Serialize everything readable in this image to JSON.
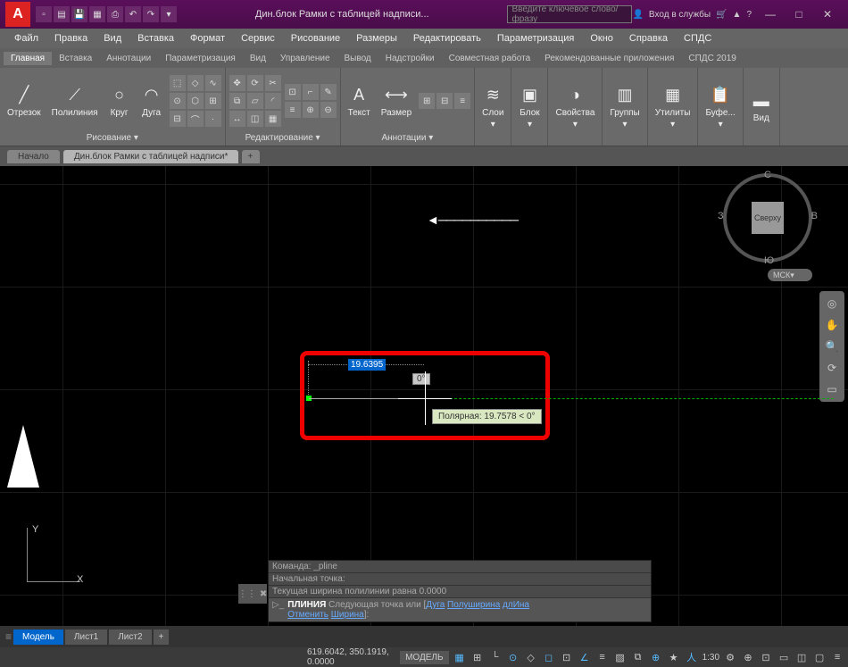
{
  "title": "Дин.блок Рамки с таблицей надписи...",
  "search_placeholder": "Введите ключевое слово/фразу",
  "login_label": "Вход в службы",
  "menus": [
    "Файл",
    "Правка",
    "Вид",
    "Вставка",
    "Формат",
    "Сервис",
    "Рисование",
    "Размеры",
    "Редактировать",
    "Параметризация",
    "Окно",
    "Справка",
    "СПДС"
  ],
  "ribbon_tabs": [
    "Главная",
    "Вставка",
    "Аннотации",
    "Параметризация",
    "Вид",
    "Управление",
    "Вывод",
    "Надстройки",
    "Совместная работа",
    "Рекомендованные приложения",
    "СПДС 2019"
  ],
  "panels": {
    "draw": {
      "title": "Рисование ▾",
      "btns": [
        "Отрезок",
        "Полилиния",
        "Круг",
        "Дуга"
      ]
    },
    "edit": {
      "title": "Редактирование ▾"
    },
    "anno": {
      "title": "Аннотации ▾",
      "btns": [
        "Текст",
        "Размер"
      ]
    },
    "layers": {
      "label": "Слои"
    },
    "block": {
      "label": "Блок"
    },
    "props": {
      "label": "Свойства"
    },
    "groups": {
      "label": "Группы"
    },
    "utils": {
      "label": "Утилиты"
    },
    "clip": {
      "label": "Буфе..."
    },
    "view": {
      "label": "Вид"
    }
  },
  "doc_tabs": [
    "Начало",
    "Дин.блок Рамки с таблицей надписи*"
  ],
  "viewcube": {
    "face": "Сверху",
    "n": "С",
    "s": "Ю",
    "e": "В",
    "w": "З",
    "cs": "МСК"
  },
  "drawing": {
    "dist_input": "19.6395",
    "angle_input": "0°",
    "tooltip": "Полярная: 19.7578 < 0°"
  },
  "cmd": {
    "l1": "Команда: _pline",
    "l2": "Начальная точка:",
    "l3": "Текущая ширина полилинии равна 0.0000",
    "prompt_cmd": "ПЛИНИЯ",
    "prompt_pre": "Следующая  точка  или  [",
    "o1": "Дуга",
    "o2": "Полуширина",
    "o3": "длИна",
    "prompt_line2_pre": "Отменить",
    "o4": "Ширина",
    "prompt_end": "]:"
  },
  "bottom_tabs": [
    "Модель",
    "Лист1",
    "Лист2"
  ],
  "status": {
    "coords": "619.6042, 350.1919, 0.0000",
    "model": "МОДЕЛЬ",
    "scale": "1:30"
  },
  "ucs": {
    "x": "X",
    "y": "Y"
  }
}
